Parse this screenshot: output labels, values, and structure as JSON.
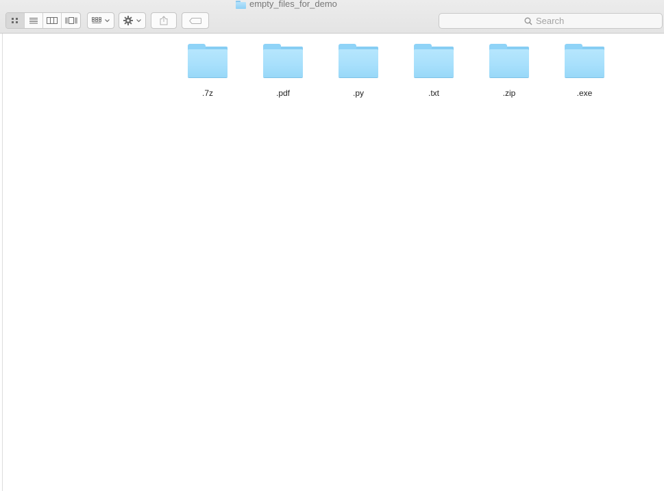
{
  "window": {
    "title": "empty_files_for_demo",
    "title_icon": "folder-icon"
  },
  "toolbar": {
    "view_modes": [
      {
        "name": "icon-view",
        "icon": "grid-icon",
        "active": true
      },
      {
        "name": "list-view",
        "icon": "list-icon",
        "active": false
      },
      {
        "name": "column-view",
        "icon": "columns-icon",
        "active": false
      },
      {
        "name": "cover-flow-view",
        "icon": "cover-flow-icon",
        "active": false
      }
    ],
    "arrange_icon": "arrange-grid-icon",
    "action_icon": "gear-icon",
    "share_icon": "share-icon",
    "tags_icon": "tag-icon",
    "search": {
      "placeholder": "Search",
      "value": ""
    }
  },
  "files": [
    {
      "name": ".7z",
      "icon": "folder-icon"
    },
    {
      "name": ".pdf",
      "icon": "folder-icon"
    },
    {
      "name": ".py",
      "icon": "folder-icon"
    },
    {
      "name": ".txt",
      "icon": "folder-icon"
    },
    {
      "name": ".zip",
      "icon": "folder-icon"
    },
    {
      "name": ".exe",
      "icon": "folder-icon"
    }
  ],
  "colors": {
    "folder_light": "#b6e6fd",
    "folder_dark": "#86cdf3",
    "toolbar_bg": "#ececec"
  }
}
